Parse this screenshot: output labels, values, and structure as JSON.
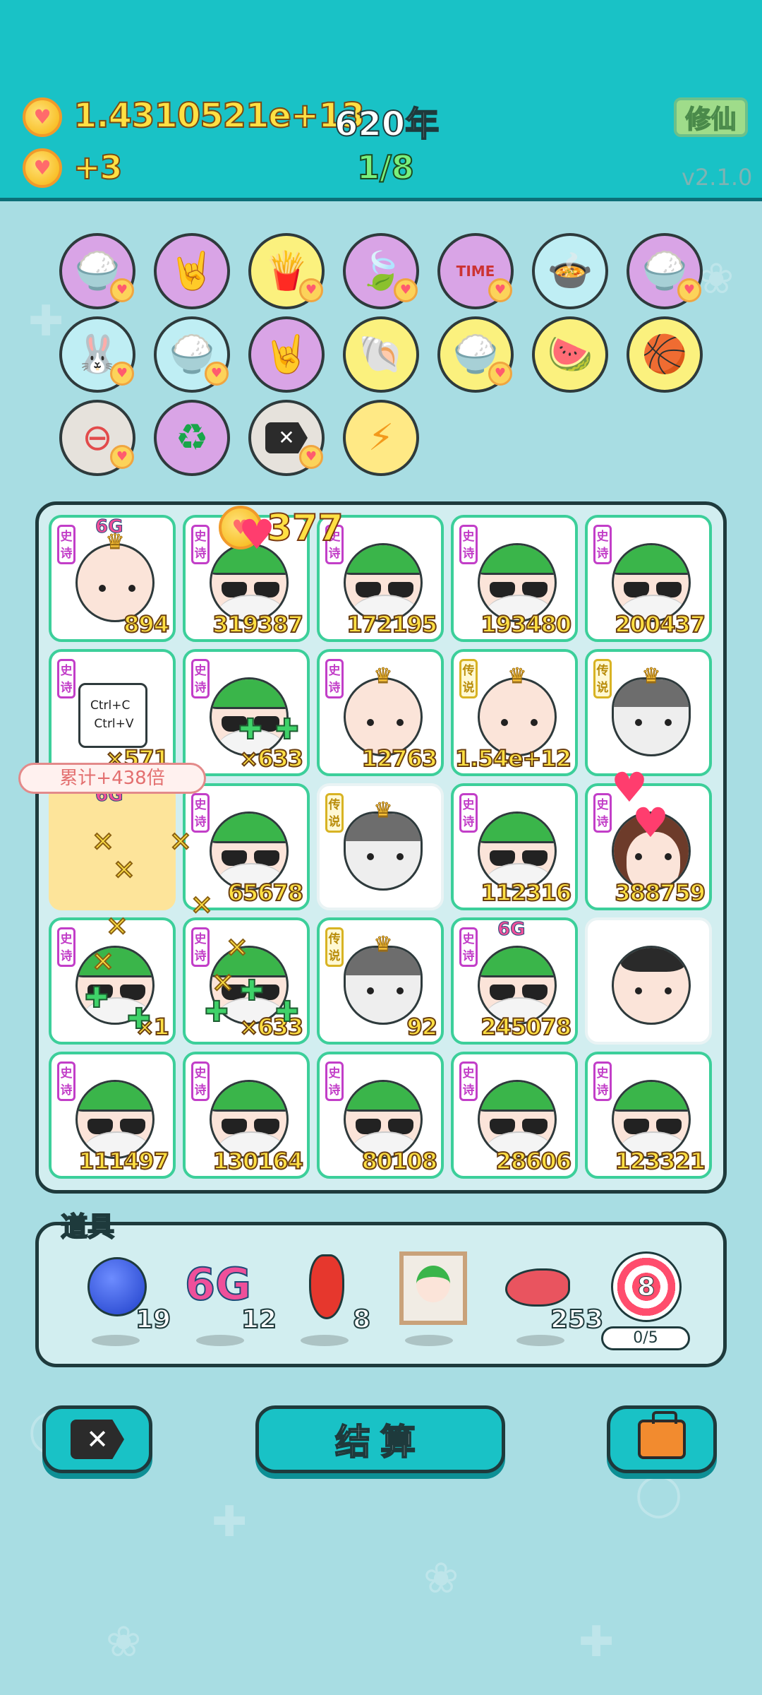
{
  "header": {
    "coins": "1.4310521e+13",
    "years": "620年",
    "coin_rate": "+3",
    "progress": "1/8",
    "xiuxian_label": "修仙",
    "version": "v2.1.0"
  },
  "skill_row1": [
    "rice-bowl",
    "rock-hand",
    "fries",
    "leaf",
    "time-magazine",
    "pot-duck",
    "rice-bowl"
  ],
  "skill_row2": [
    "rabbit",
    "rice-bowl",
    "rock-hand",
    "shell",
    "rice-bowl",
    "fruit-basket",
    "basketballs"
  ],
  "skill_row3": [
    "minus",
    "recycle",
    "backspace",
    "lightning"
  ],
  "board": {
    "floating_gain": "377",
    "tooltip": "累计+438倍",
    "rows": [
      [
        {
          "tag": "史诗",
          "value": "894",
          "badge": "6G",
          "type": "king"
        },
        {
          "tag": "史诗",
          "value": "319387",
          "type": "green-heart"
        },
        {
          "tag": "史诗",
          "value": "172195",
          "type": "green"
        },
        {
          "tag": "史诗",
          "value": "193480",
          "type": "green"
        },
        {
          "tag": "史诗",
          "value": "200437",
          "type": "green"
        }
      ],
      [
        {
          "tag": "史诗",
          "value": "×571",
          "type": "ctrl"
        },
        {
          "tag": "史诗",
          "value": "×633",
          "type": "green"
        },
        {
          "tag": "史诗",
          "value": "12763",
          "type": "king"
        },
        {
          "tag": "传说",
          "value": "1.54e+12",
          "type": "king-heart"
        },
        {
          "tag": "传说",
          "value": "",
          "type": "dog"
        }
      ],
      [
        {
          "tag": "",
          "value": "",
          "badge": "6G",
          "type": "highlight"
        },
        {
          "tag": "史诗",
          "value": "65678",
          "type": "green"
        },
        {
          "tag": "传说",
          "value": "",
          "type": "dog"
        },
        {
          "tag": "史诗",
          "value": "112316",
          "type": "green"
        },
        {
          "tag": "史诗",
          "value": "388759",
          "type": "girl"
        }
      ],
      [
        {
          "tag": "史诗",
          "value": "×1",
          "type": "green-big"
        },
        {
          "tag": "史诗",
          "value": "×633",
          "type": "green-big"
        },
        {
          "tag": "传说",
          "value": "92",
          "type": "dog"
        },
        {
          "tag": "史诗",
          "value": "245078",
          "badge": "6G",
          "type": "green"
        },
        {
          "tag": "",
          "value": "",
          "type": "man"
        }
      ],
      [
        {
          "tag": "史诗",
          "value": "111497",
          "type": "green"
        },
        {
          "tag": "史诗",
          "value": "130164",
          "type": "green"
        },
        {
          "tag": "史诗",
          "value": "80108",
          "type": "green"
        },
        {
          "tag": "史诗",
          "value": "28606",
          "type": "green"
        },
        {
          "tag": "史诗",
          "value": "123321",
          "type": "green"
        }
      ]
    ]
  },
  "items_panel": {
    "title": "道具",
    "items": [
      {
        "name": "blueberry",
        "count": "19"
      },
      {
        "name": "6g",
        "label": "6G",
        "count": "12"
      },
      {
        "name": "chili",
        "count": "8"
      },
      {
        "name": "portrait",
        "count": ""
      },
      {
        "name": "liver",
        "count": "253"
      },
      {
        "name": "target",
        "label": "8",
        "count": "0/5"
      }
    ]
  },
  "bottom": {
    "settle_label": "结算"
  },
  "colors": {
    "header_bg": "#19c2c6",
    "page_bg": "#a8dde3",
    "board_bg": "#d2eef0",
    "epic_tag": "#c23ec8",
    "legend_tag": "#d8b323"
  }
}
